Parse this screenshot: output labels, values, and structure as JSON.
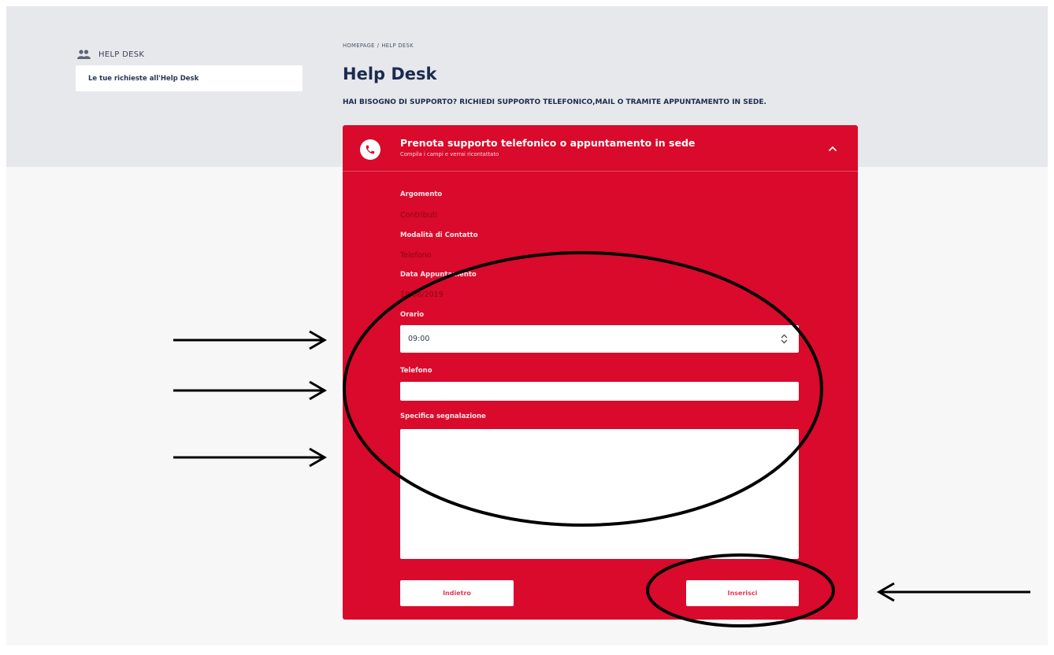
{
  "sidebar": {
    "section_title": "HELP DESK",
    "section_icon": "users-icon",
    "link_label": "Le tue richieste all'Help Desk"
  },
  "breadcrumb": {
    "home": "HOMEPAGE",
    "separator": "/",
    "current": "HELP DESK"
  },
  "page": {
    "title": "Help Desk",
    "subtitle": "HAI BISOGNO DI SUPPORTO? RICHIEDI SUPPORTO TELEFONICO,MAIL O TRAMITE APPUNTAMENTO IN SEDE."
  },
  "card": {
    "icon": "phone-icon",
    "title": "Prenota supporto telefonico o appuntamento in sede",
    "subtitle": "Compila i campi e verrai ricontattato",
    "collapse_icon": "chevron-up-icon",
    "accent_color": "#d90a2b"
  },
  "form": {
    "argomento_label": "Argomento",
    "argomento_value": "Contributi",
    "modalita_label": "Modalità di Contatto",
    "modalita_value": "Telefono",
    "data_label": "Data Appuntamento",
    "data_value": "18/06/2019",
    "orario_label": "Orario",
    "orario_value": "09:00",
    "telefono_label": "Telefono",
    "telefono_value": "",
    "segnalazione_label": "Specifica segnalazione",
    "segnalazione_value": ""
  },
  "buttons": {
    "back": "Indietro",
    "submit": "Inserisci"
  },
  "annotations": {
    "ink_color": "#000000",
    "arrows": [
      "arrow-orario",
      "arrow-telefono",
      "arrow-segnalazione",
      "arrow-inserisci"
    ],
    "highlights": [
      "form-fields-ellipse",
      "submit-button-ellipse"
    ]
  }
}
